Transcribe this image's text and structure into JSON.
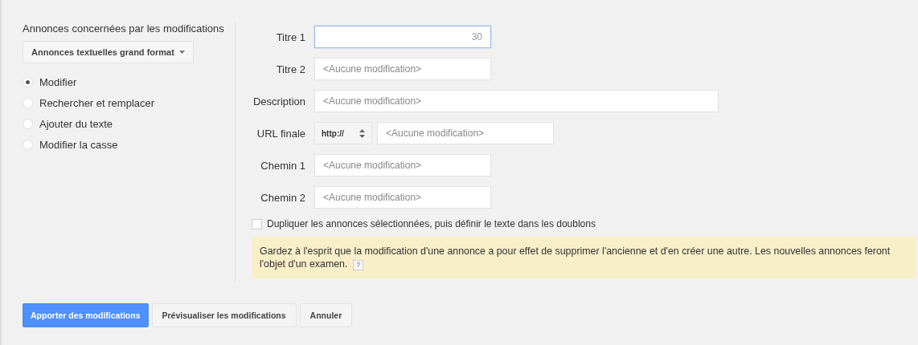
{
  "left_panel": {
    "title": "Annonces concernées par les modifications",
    "ad_type_dropdown": "Annonces textuelles grand format",
    "modes": [
      {
        "label": "Modifier",
        "selected": true
      },
      {
        "label": "Rechercher et remplacer",
        "selected": false
      },
      {
        "label": "Ajouter du texte",
        "selected": false
      },
      {
        "label": "Modifier la casse",
        "selected": false
      }
    ]
  },
  "fields": [
    {
      "kind": "text",
      "label": "Titre 1",
      "focused": true,
      "counter": "30"
    },
    {
      "kind": "text",
      "label": "Titre 2",
      "focused": false,
      "placeholder": "<Aucune modification>"
    },
    {
      "kind": "long_text",
      "label": "Description",
      "focused": false,
      "placeholder": "<Aucune modification>"
    },
    {
      "kind": "url",
      "label": "URL finale",
      "focused": false,
      "protocol": "http://",
      "placeholder": "<Aucune modification>"
    },
    {
      "kind": "text",
      "label": "Chemin 1",
      "focused": false,
      "placeholder": "<Aucune modification>"
    },
    {
      "kind": "text",
      "label": "Chemin 2",
      "focused": false,
      "placeholder": "<Aucune modification>"
    }
  ],
  "duplicate_option": {
    "label": "Dupliquer les annonces sélectionnées, puis définir le texte dans les doublons",
    "checked": false
  },
  "notice": {
    "text": "Gardez à l'esprit que la modification d'une annonce a pour effet de supprimer l'ancienne et d'en créer une autre. Les nouvelles annonces feront l'objet d'un examen.",
    "help": "?"
  },
  "buttons": [
    {
      "kind": "primary",
      "label": "Apporter des modifications"
    },
    {
      "kind": "secondary",
      "label": "Prévisualiser les modifications"
    },
    {
      "kind": "secondary",
      "label": "Annuler"
    }
  ]
}
